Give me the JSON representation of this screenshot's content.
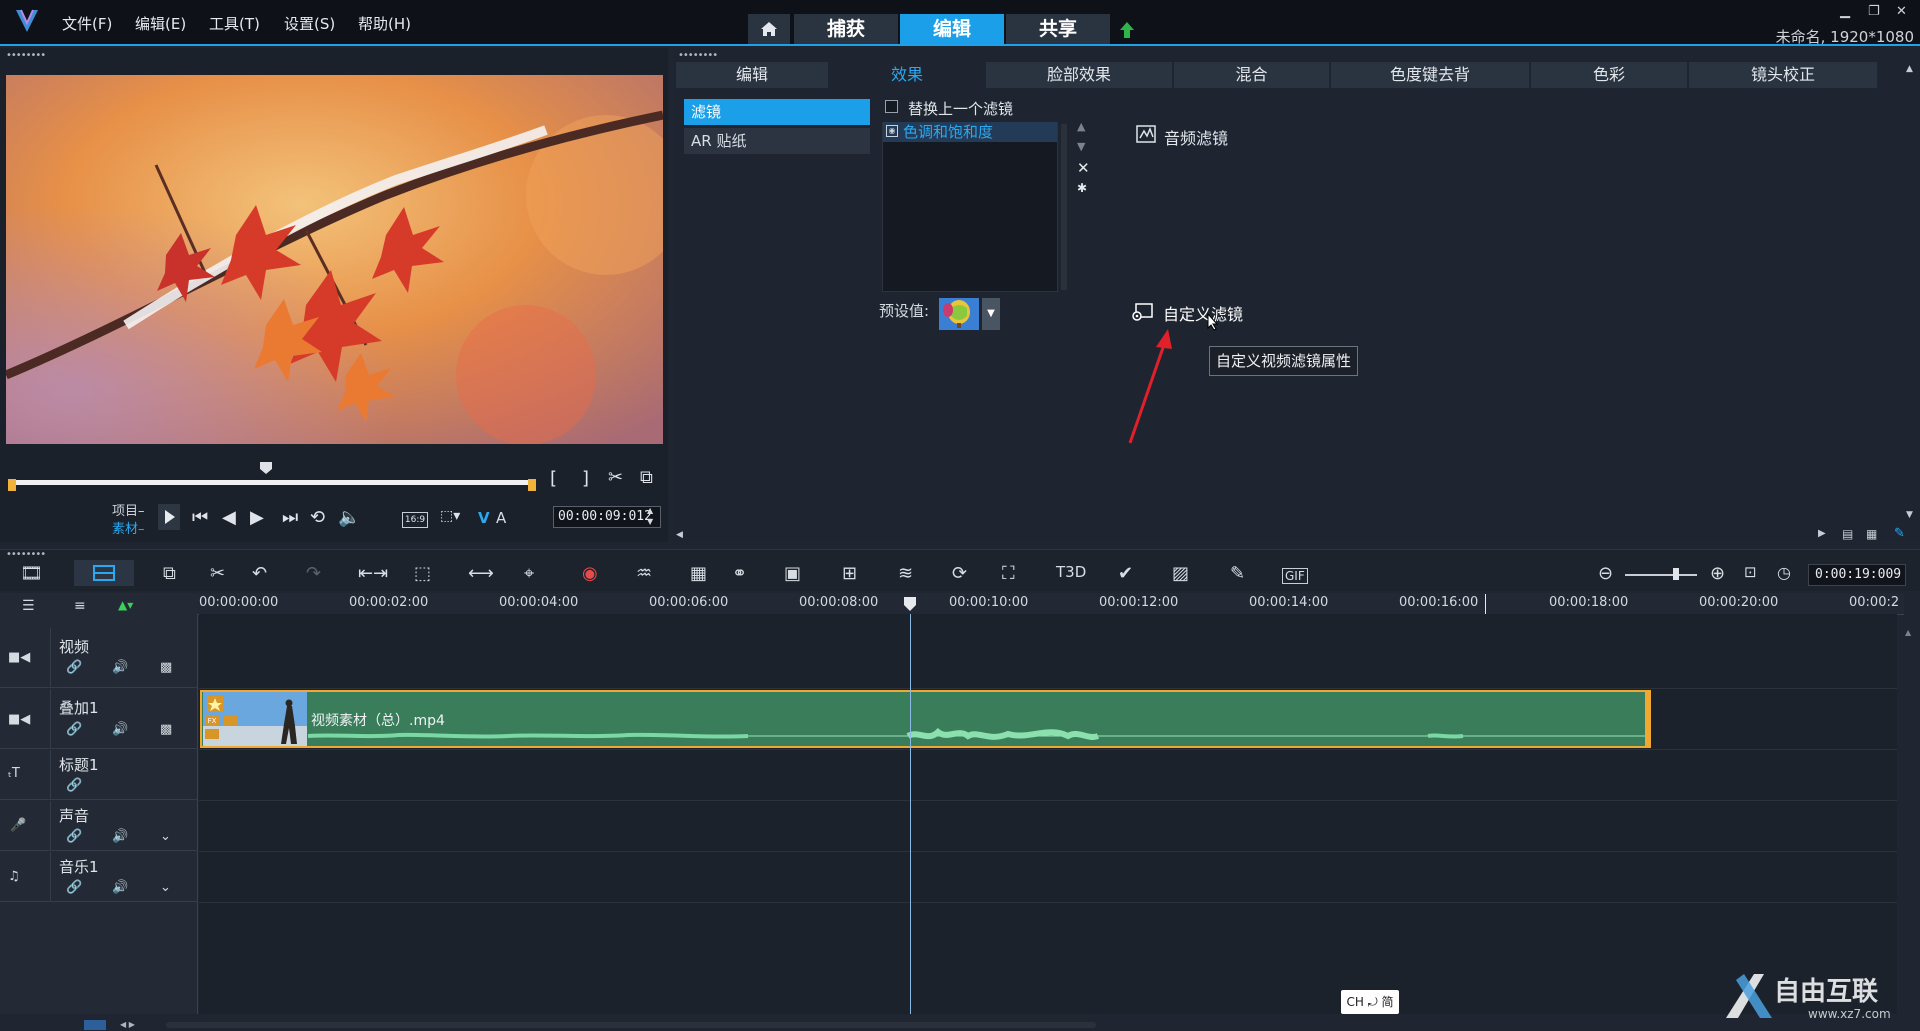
{
  "menu": {
    "items": [
      "文件(F)",
      "编辑(E)",
      "工具(T)",
      "设置(S)",
      "帮助(H)"
    ]
  },
  "modes": {
    "capture": "捕获",
    "edit": "编辑",
    "share": "共享"
  },
  "project_info": "未命名, 1920*1080",
  "player": {
    "project_label": "项目–",
    "clip_label": "素材–",
    "timecode": "00:00:09:012",
    "aspect": "16:9",
    "v_label": "V",
    "a_label": "A"
  },
  "fx_tabs": [
    "编辑",
    "效果",
    "脸部效果",
    "混合",
    "色度键去背",
    "色彩",
    "镜头校正"
  ],
  "categories": {
    "filter": "滤镜",
    "ar": "AR 贴纸"
  },
  "filters": {
    "replace_label": "替换上一个滤镜",
    "applied": "色调和饱和度",
    "preset_label": "预设值:",
    "audio_filter": "音频滤镜",
    "custom_filter": "自定义滤镜",
    "tooltip": "自定义视频滤镜属性"
  },
  "timeline": {
    "timecode": "0:00:19:009",
    "ruler": [
      "00:00:00:00",
      "00:00:02:00",
      "00:00:04:00",
      "00:00:06:00",
      "00:00:08:00",
      "00:00:10:00",
      "00:00:12:00",
      "00:00:14:00",
      "00:00:16:00",
      "00:00:18:00",
      "00:00:20:00",
      "00:00:2"
    ],
    "tracks": [
      "视频",
      "叠加1",
      "标题1",
      "声音",
      "音乐1"
    ],
    "clip_name": "视频素材（总）.mp4"
  },
  "ime": "CH ⤾ 简",
  "watermark": {
    "title": "自由互联",
    "url": "www.xz7.com"
  },
  "colors": {
    "accent": "#1a9fe8",
    "clip": "#3a7d5a",
    "clip_border": "#f1a833",
    "arrow": "#e0202a"
  }
}
